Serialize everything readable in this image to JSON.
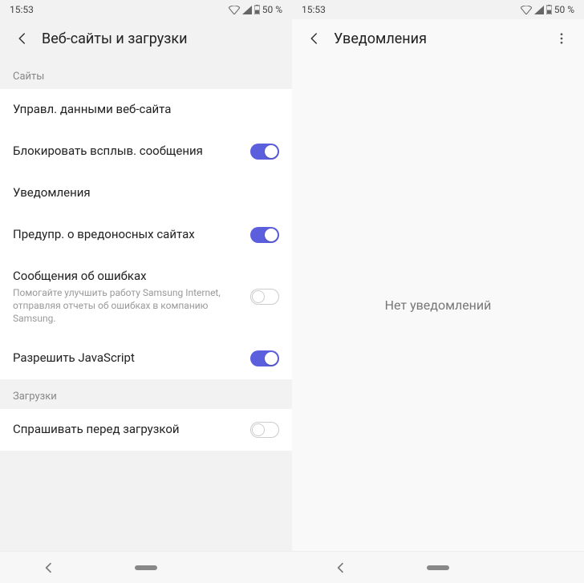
{
  "status": {
    "time": "15:53",
    "battery_text": "50 %"
  },
  "left": {
    "title": "Веб-сайты и загрузки",
    "section_sites": "Сайты",
    "section_downloads": "Загрузки",
    "items": {
      "manage_data": "Управл. данными веб-сайта",
      "block_popups": "Блокировать всплыв. сообщения",
      "notifications": "Уведомления",
      "warn_malicious": "Предупр. о вредоносных сайтах",
      "error_reports": "Сообщения об ошибках",
      "error_reports_sub": "Помогайте улучшить работу Samsung Internet, отправляя отчеты об ошибках в компанию Samsung.",
      "allow_js": "Разрешить JavaScript",
      "ask_download": "Спрашивать перед загрузкой"
    }
  },
  "right": {
    "title": "Уведомления",
    "empty": "Нет уведомлений"
  }
}
